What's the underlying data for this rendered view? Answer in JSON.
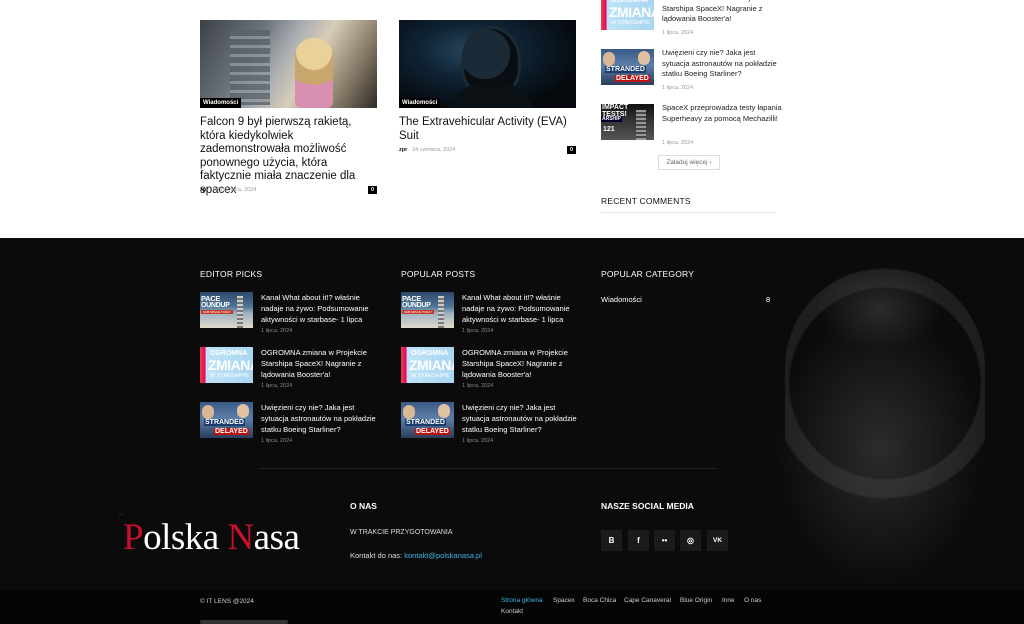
{
  "cards": [
    {
      "badge": "Wiadomości",
      "title": "Falcon 9 był pierwszą rakietą, która kiedykolwiek zademonstrowała możliwość ponownego użycia, która faktycznie miała znaczenie dla spacex",
      "author": "zpr",
      "date": "24 czerwca, 2024",
      "comments": "0"
    },
    {
      "badge": "Wiadomości",
      "title": "The Extravehicular Activity (EVA) Suit",
      "author": "zpr",
      "date": "24 czerwca, 2024",
      "comments": "0"
    }
  ],
  "sidebar": {
    "items": [
      {
        "title": "OGROMNA zmiana w Projekcie Starshipa SpaceX! Nagranie z lądowania Booster'a!",
        "date": "1 lipca, 2024"
      },
      {
        "title": "Uwięzieni czy nie? Jaka jest sytuacja astronautów na pokładzie statku Boeing Starliner?",
        "date": "1 lipca, 2024"
      },
      {
        "title": "SpaceX przeprowadza testy łapania Superheavy za pomocą Mechazilli!",
        "date": "1 lipca, 2024"
      }
    ],
    "load_more": "Załaduj więcej",
    "recent_comments": "RECENT COMMENTS"
  },
  "thumbs": {
    "space": {
      "l1": "PACE",
      "l2": "OUNDUP",
      "l3": "SUB SPACE TODAY"
    },
    "ogrom": {
      "w1": "OGROMNA",
      "w2": "ZMIANA",
      "w3": "W STARSHIPIE"
    },
    "strand": {
      "w1": "STRANDED",
      "w2": "DELAYED"
    },
    "impact": {
      "w1": "IMPACT TESTS!",
      "w2": "ARSHIP",
      "w3": "121"
    }
  },
  "footer": {
    "editor_picks": {
      "heading": "EDITOR PICKS",
      "items": [
        {
          "title": "Kanał What about it!? właśnie nadaje na żywo: Podsumowanie aktywności w starbase- 1 lipca",
          "date": "1 lipca, 2024"
        },
        {
          "title": "OGROMNA zmiana w Projekcie Starshipa SpaceX! Nagranie z lądowania Booster'a!",
          "date": "1 lipca, 2024"
        },
        {
          "title": "Uwięzieni czy nie? Jaka jest sytuacja astronautów na pokładzie statku Boeing Starliner?",
          "date": "1 lipca, 2024"
        }
      ]
    },
    "popular_posts": {
      "heading": "POPULAR POSTS",
      "items": [
        {
          "title": "Kanał What about it!? właśnie nadaje na żywo: Podsumowanie aktywności w starbase- 1 lipca",
          "date": "1 lipca, 2024"
        },
        {
          "title": "OGROMNA zmiana w Projekcie Starshipa SpaceX! Nagranie z lądowania Booster'a!",
          "date": "1 lipca, 2024"
        },
        {
          "title": "Uwięzieni czy nie? Jaka jest sytuacja astronautów na pokładzie statku Boeing Starliner?",
          "date": "1 lipca, 2024"
        }
      ]
    },
    "popular_category": {
      "heading": "POPULAR CATEGORY",
      "name": "Wiadomości",
      "count": "8"
    },
    "logo": {
      "tiny": "...",
      "polish_red_1": "P",
      "white_1": "olska",
      "red_2": "N",
      "white_2": "asa"
    },
    "onas": {
      "heading": "O NAS",
      "text": "W TRAKCIE PRZYGOTOWANIA",
      "contact_label": "Kontakt do nas:",
      "contact_email": "kontakt@polskanasa.pl"
    },
    "social": {
      "heading": "NASZE SOCIAL MEDIA",
      "icons": [
        "B",
        "f",
        "••",
        "◎",
        "VK"
      ]
    },
    "copyright": "© IT LENS @2024",
    "nav": [
      "Strona główna",
      "Spacex",
      "Boca Chica",
      "Cape Canaveral",
      "Blue Origin",
      "Inne",
      "O nas",
      "Kontakt"
    ]
  },
  "colors": {
    "accent": "#3db4e5",
    "logo_red": "#c8102e",
    "footer_bg": "#0b0b0b"
  }
}
